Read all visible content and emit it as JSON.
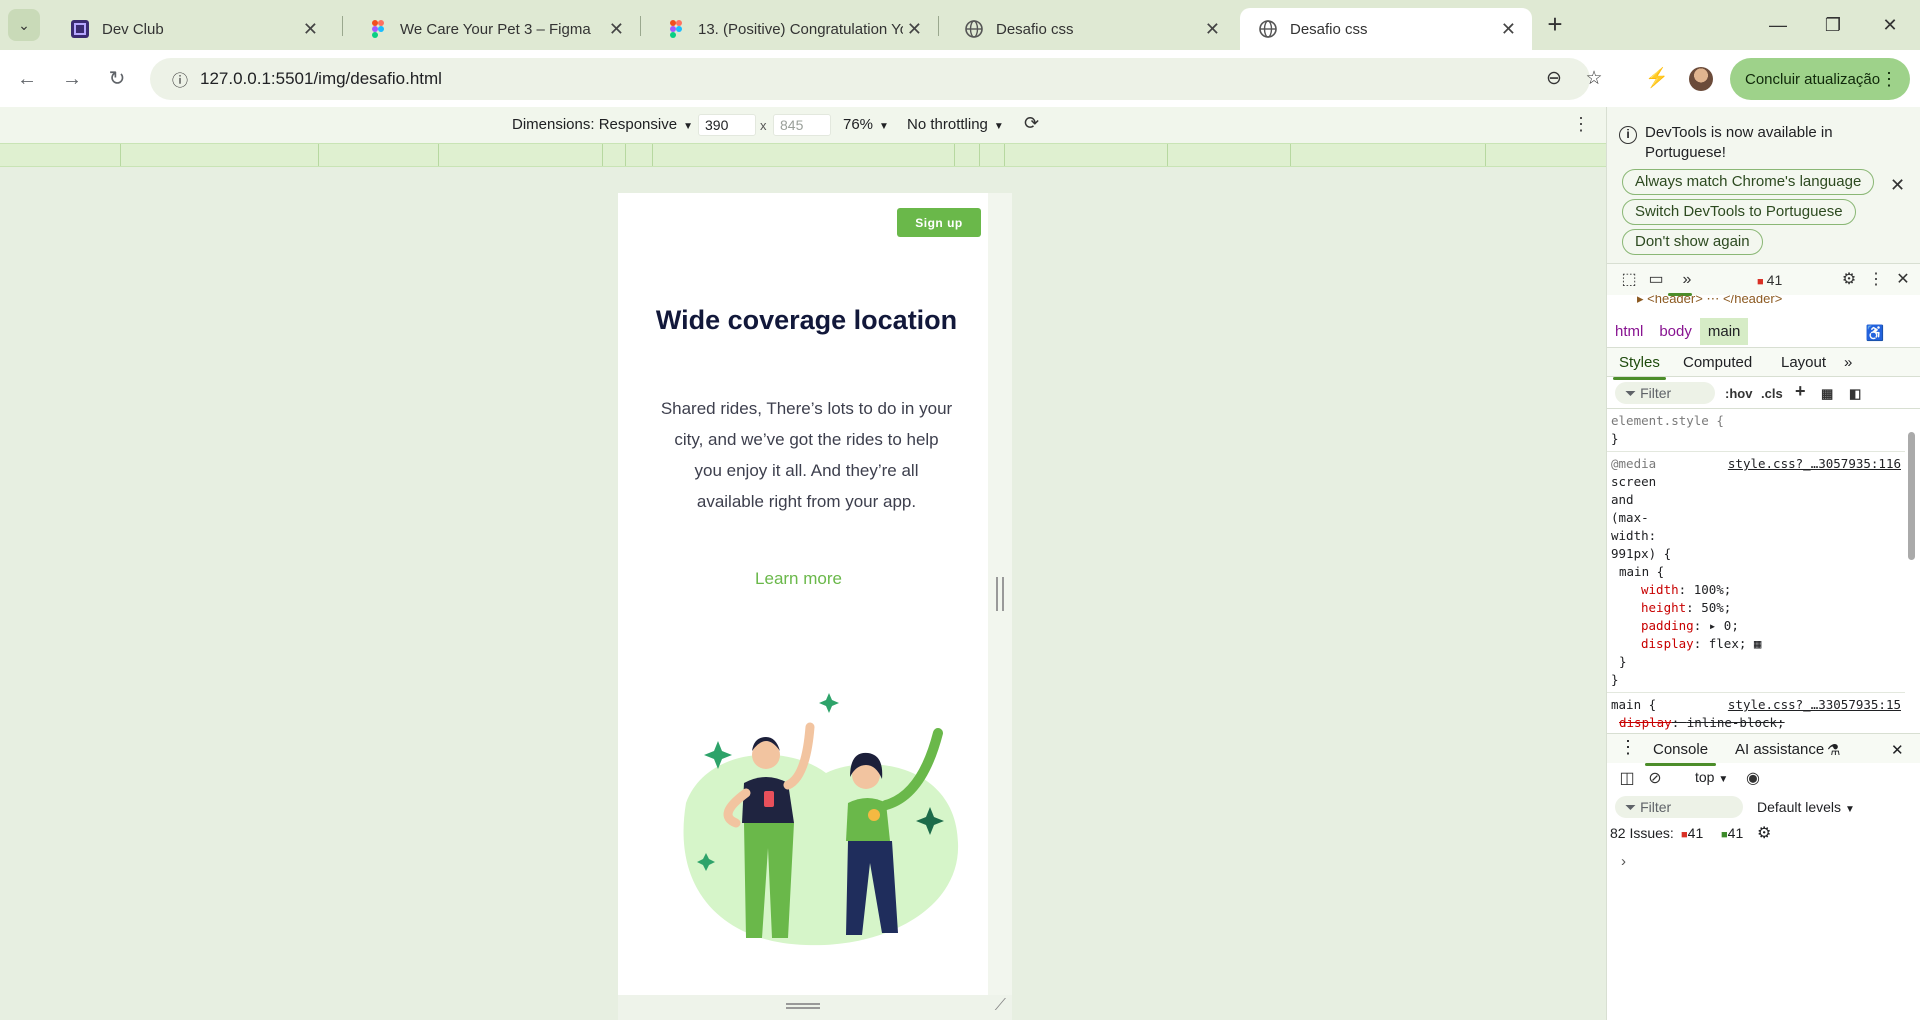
{
  "browser": {
    "tabs": [
      {
        "title": "Dev Club",
        "favicon": "devclub-icon",
        "active": false
      },
      {
        "title": "We Care Your Pet 3 – Figma",
        "favicon": "figma-icon",
        "active": false
      },
      {
        "title": "13. (Positive) Congratulation Yo",
        "favicon": "figma-icon",
        "active": false
      },
      {
        "title": "Desafio css",
        "favicon": "globe-icon",
        "active": false
      },
      {
        "title": "Desafio css",
        "favicon": "globe-icon",
        "active": true
      }
    ],
    "tab_close": "✕",
    "new_tab": "+",
    "url": "127.0.0.1:5501/img/desafio.html",
    "update_button": "Concluir atualização"
  },
  "emulation": {
    "dimensions_label": "Dimensions: Responsive",
    "width": "390",
    "height": "845",
    "x_sep": "x",
    "zoom": "76%",
    "throttle": "No throttling"
  },
  "page": {
    "signup": "Sign up",
    "title": "Wide coverage location",
    "text": "Shared rides, There’s lots to do in your city, and we’ve got the rides to help you enjoy it all. And they’re all available right from your app.",
    "learn_more": "Learn more",
    "colors": {
      "accent": "#6ab84a",
      "title": "#12183a",
      "blob": "#d6f5c9"
    }
  },
  "devtools": {
    "notice": "DevTools is now available in Portuguese!",
    "buttons": [
      "Always match Chrome's language",
      "Switch DevTools to Portuguese",
      "Don't show again"
    ],
    "error_count": "41",
    "dom_peek": "▸ <header> ⋯ </header>",
    "breadcrumb": [
      "html",
      "body",
      "main"
    ],
    "tabs": [
      "Styles",
      "Computed",
      "Layout"
    ],
    "filter_placeholder": "Filter",
    "hov": ":hov",
    "cls": ".cls",
    "styles": {
      "element_style": "element.style {",
      "close": "}",
      "media_lines": [
        "@media",
        "screen",
        "and",
        "(max-",
        "width:",
        "991px) {"
      ],
      "media_link": "style.css?_…3057935:116",
      "main_open": "main {",
      "props": [
        {
          "name": "width",
          "value": "100%;"
        },
        {
          "name": "height",
          "value": "50%;"
        },
        {
          "name": "padding",
          "value": "▸ 0;"
        },
        {
          "name": "display",
          "value": "flex;"
        }
      ],
      "main2_link": "style.css?_…33057935:15",
      "struck_prop": "display",
      "struck_value": "inline-block;"
    },
    "console": {
      "tabs": [
        "Console",
        "AI assistance"
      ],
      "context": "top",
      "filter": "Filter",
      "levels": "Default levels",
      "issues_label": "82 Issues:",
      "issues_errors": "41",
      "issues_info": "41",
      "prompt": "›"
    }
  }
}
